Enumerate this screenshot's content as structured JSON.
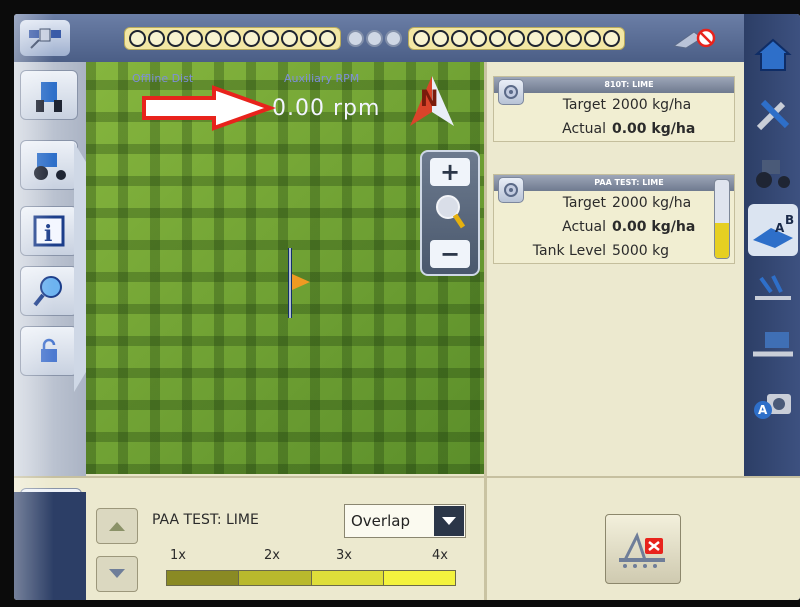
{
  "map": {
    "offline_dist_label": "Offline Dist",
    "aux_rpm_label": "Auxiliary RPM",
    "aux_rpm_value": "0.00 rpm",
    "compass_letter": "N",
    "zoom_in": "+",
    "zoom_out": "−"
  },
  "products": [
    {
      "name": "810T: LIME",
      "target_label": "Target",
      "target_value": "2000 kg/ha",
      "actual_label": "Actual",
      "actual_value": "0.00 kg/ha"
    },
    {
      "name": "PAA TEST: LIME",
      "target_label": "Target",
      "target_value": "2000 kg/ha",
      "actual_label": "Actual",
      "actual_value": "0.00 kg/ha",
      "tank_label": "Tank Level",
      "tank_value": "5000 kg",
      "tank_fill_fraction": 0.45
    }
  ],
  "legend": {
    "title": "PAA TEST: LIME",
    "mode_selected": "Overlap",
    "ticks": [
      "1x",
      "2x",
      "3x",
      "4x"
    ],
    "swatch_colors": [
      "#8a8a24",
      "#b9b92d",
      "#dede3a",
      "#f3f33e"
    ]
  },
  "colors": {
    "accent_blue": "#2c3e66",
    "annotation_red": "#e8231c",
    "tank_yellow": "#e6cf22"
  },
  "icons": {
    "topbar": [
      "satellite-icon",
      "gps-no-signal-icon"
    ],
    "right_rail": [
      "home-icon",
      "tools-icon",
      "tractor-icon",
      "ab-guidance-icon",
      "implement-icon",
      "seeder-icon",
      "camera-a-icon"
    ],
    "left_rail": [
      "tractor-view-icon",
      "tractor-side-icon",
      "info-icon",
      "magnifier-icon",
      "lock-icon"
    ],
    "bottom": [
      "layers-icon",
      "implement-error-icon"
    ]
  }
}
